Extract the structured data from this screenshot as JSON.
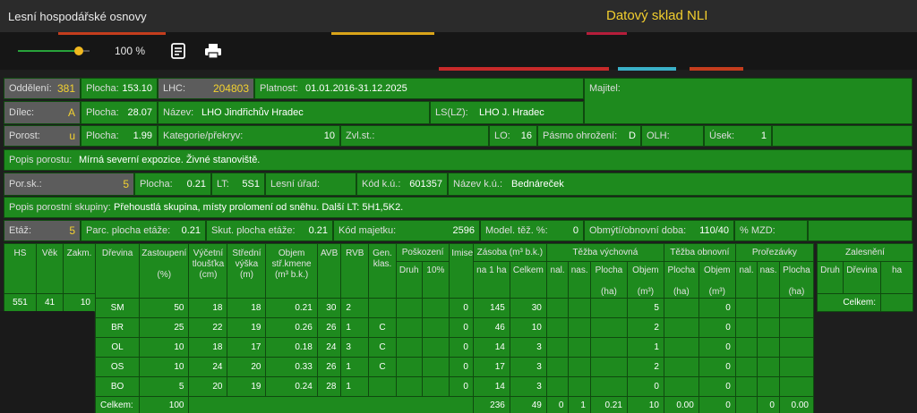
{
  "header": {
    "title": "Lesní hospodářské osnovy",
    "subtitle": "Datový sklad NLI"
  },
  "toolbar": {
    "zoom": "100 %",
    "zoom_fraction": 0.85,
    "icons": [
      "notes-icon",
      "print-icon"
    ]
  },
  "colors": {
    "field_green": "#1e8a1e",
    "field_gray": "#5c5c5c",
    "highlight_yellow": "#f3d230",
    "slider_green": "#28a33a",
    "slider_thumb": "#f1b81f"
  },
  "form": {
    "oddeleni": {
      "label": "Oddělení:",
      "value": "381"
    },
    "plocha1": {
      "label": "Plocha:",
      "value": "153.10"
    },
    "lhc": {
      "label": "LHC:",
      "value": "204803"
    },
    "platnost": {
      "label": "Platnost:",
      "value": "01.01.2016-31.12.2025"
    },
    "majitel": {
      "label": "Majitel:",
      "value": ""
    },
    "dilec": {
      "label": "Dílec:",
      "value": "A"
    },
    "plocha2": {
      "label": "Plocha:",
      "value": "28.07"
    },
    "nazev": {
      "label": "Název:",
      "value": "LHO Jindřichův Hradec"
    },
    "ls": {
      "label": "LS(LZ):",
      "value": "LHO J. Hradec"
    },
    "porost": {
      "label": "Porost:",
      "value": "u"
    },
    "plocha3": {
      "label": "Plocha:",
      "value": "1.99"
    },
    "kategorie": {
      "label": "Kategorie/překryv:",
      "value": "10"
    },
    "zvlst": {
      "label": "Zvl.st.:",
      "value": ""
    },
    "lo": {
      "label": "LO:",
      "value": "16"
    },
    "pasmo": {
      "label": "Pásmo ohrožení:",
      "value": "D"
    },
    "olh": {
      "label": "OLH:",
      "value": ""
    },
    "usek": {
      "label": "Úsek:",
      "value": "1"
    },
    "popis_porostu": {
      "label": "Popis porostu:",
      "value": "Mírná severní expozice. Živné stanoviště."
    },
    "porsk": {
      "label": "Por.sk.:",
      "value": "5"
    },
    "plocha4": {
      "label": "Plocha:",
      "value": "0.21"
    },
    "lt": {
      "label": "LT:",
      "value": "5S1"
    },
    "lesni_urad": {
      "label": "Lesní úřad:",
      "value": ""
    },
    "kod_ku": {
      "label": "Kód k.ú.:",
      "value": "601357"
    },
    "nazev_ku": {
      "label": "Název k.ú.:",
      "value": "Bednáreček"
    },
    "popis_skupiny": {
      "label": "Popis porostní skupiny:",
      "value": "Přehoustlá skupina, místy prolomení od sněhu. Další LT: 5H1,5K2."
    },
    "etaz": {
      "label": "Etáž:",
      "value": "5"
    },
    "parc_plocha": {
      "label": "Parc. plocha etáže:",
      "value": "0.21"
    },
    "skut_plocha": {
      "label": "Skut. plocha etáže:",
      "value": "0.21"
    },
    "kod_majetku": {
      "label": "Kód majetku:",
      "value": "2596"
    },
    "model_tez": {
      "label": "Model. těž. %:",
      "value": "0"
    },
    "obmyti": {
      "label": "Obmýtí/obnovní doba:",
      "value": "110/40"
    },
    "mzd": {
      "label": "% MZD:",
      "value": ""
    }
  },
  "stand_table": {
    "headers": [
      "HS",
      "Věk",
      "Zakm."
    ],
    "row": [
      "551",
      "41",
      "10"
    ]
  },
  "species_table": {
    "headers": {
      "drevina": "Dřevina",
      "zastoupeni": "Zastoupení",
      "zastoupeni_unit": "(%)",
      "vycetni": "Výčetní",
      "vycetni2": "tloušťka",
      "vycetni_unit": "(cm)",
      "stredni": "Střední",
      "stredni2": "výška",
      "stredni_unit": "(m)",
      "objem": "Objem",
      "objem2": "stř.kmene",
      "objem_unit": "(m³ b.k.)",
      "avb": "AVB",
      "rvb": "RVB",
      "gen": "Gen.",
      "gen2": "klas.",
      "poskozeni": "Poškození",
      "druh": "Druh",
      "pct10": "10%",
      "imise": "Imise",
      "zasoba": "Zásoba (m³ b.k.)",
      "na1ha": "na 1 ha",
      "celkem": "Celkem",
      "tezba_vych": "Těžba výchovná",
      "tezba_obn": "Těžba obnovní",
      "prorezavky": "Prořezávky",
      "nal": "nal.",
      "nas": "nas.",
      "plocha": "Plocha",
      "ha": "(ha)",
      "objem_t": "Objem",
      "m3": "(m³)"
    },
    "rows": [
      {
        "drevina": "SM",
        "zast": "50",
        "tl": "18",
        "vys": "18",
        "obj": "0.21",
        "avb": "30",
        "rvb": "2",
        "gen": "",
        "druh": "",
        "p10": "",
        "imise": "0",
        "na1ha": "145",
        "celkem": "30",
        "tv_nal": "",
        "tv_nas": "",
        "tv_plocha": "",
        "tv_objem": "5",
        "to_plocha": "",
        "to_objem": "0",
        "pr_nal": "",
        "pr_nas": "",
        "pr_plocha": ""
      },
      {
        "drevina": "BR",
        "zast": "25",
        "tl": "22",
        "vys": "19",
        "obj": "0.26",
        "avb": "26",
        "rvb": "1",
        "gen": "C",
        "druh": "",
        "p10": "",
        "imise": "0",
        "na1ha": "46",
        "celkem": "10",
        "tv_nal": "",
        "tv_nas": "",
        "tv_plocha": "",
        "tv_objem": "2",
        "to_plocha": "",
        "to_objem": "0",
        "pr_nal": "",
        "pr_nas": "",
        "pr_plocha": ""
      },
      {
        "drevina": "OL",
        "zast": "10",
        "tl": "18",
        "vys": "17",
        "obj": "0.18",
        "avb": "24",
        "rvb": "3",
        "gen": "C",
        "druh": "",
        "p10": "",
        "imise": "0",
        "na1ha": "14",
        "celkem": "3",
        "tv_nal": "",
        "tv_nas": "",
        "tv_plocha": "",
        "tv_objem": "1",
        "to_plocha": "",
        "to_objem": "0",
        "pr_nal": "",
        "pr_nas": "",
        "pr_plocha": ""
      },
      {
        "drevina": "OS",
        "zast": "10",
        "tl": "24",
        "vys": "20",
        "obj": "0.33",
        "avb": "26",
        "rvb": "1",
        "gen": "C",
        "druh": "",
        "p10": "",
        "imise": "0",
        "na1ha": "17",
        "celkem": "3",
        "tv_nal": "",
        "tv_nas": "",
        "tv_plocha": "",
        "tv_objem": "2",
        "to_plocha": "",
        "to_objem": "0",
        "pr_nal": "",
        "pr_nas": "",
        "pr_plocha": ""
      },
      {
        "drevina": "BO",
        "zast": "5",
        "tl": "20",
        "vys": "19",
        "obj": "0.24",
        "avb": "28",
        "rvb": "1",
        "gen": "",
        "druh": "",
        "p10": "",
        "imise": "0",
        "na1ha": "14",
        "celkem": "3",
        "tv_nal": "",
        "tv_nas": "",
        "tv_plocha": "",
        "tv_objem": "0",
        "to_plocha": "",
        "to_objem": "0",
        "pr_nal": "",
        "pr_nas": "",
        "pr_plocha": ""
      }
    ],
    "total": {
      "label": "Celkem:",
      "zast": "100",
      "na1ha": "236",
      "celkem": "49",
      "tv_nal": "0",
      "tv_nas": "1",
      "tv_plocha": "0.21",
      "tv_objem": "10",
      "to_plocha": "0.00",
      "to_objem": "0",
      "pr_nal": "",
      "pr_nas": "0",
      "pr_plocha": "0.00"
    }
  },
  "zalesneni_table": {
    "title": "Zalesnění",
    "headers": [
      "Druh",
      "Dřevina",
      "ha"
    ],
    "total_label": "Celkem:"
  }
}
